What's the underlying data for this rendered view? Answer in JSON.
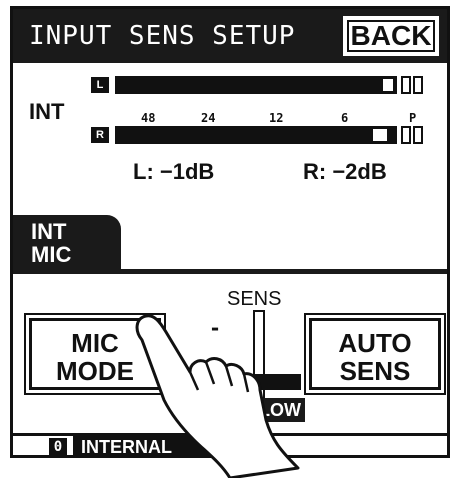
{
  "header": {
    "title": "INPUT SENS SETUP",
    "back_label": "BACK"
  },
  "meter": {
    "source_label": "INT",
    "left_badge": "L",
    "right_badge": "R",
    "scale": [
      "48",
      "24",
      "12",
      "6",
      "P"
    ],
    "left_readout": "L: −1dB",
    "right_readout": "R: −2dB"
  },
  "tab": {
    "line1": "INT",
    "line2": "MIC"
  },
  "panel": {
    "mic_mode_line1": "MIC",
    "mic_mode_line2": "MODE",
    "auto_sens_line1": "AUTO",
    "auto_sens_line2": "SENS",
    "sens_label": "SENS",
    "dash_mark": "-",
    "slider_value": "LOW"
  },
  "status": {
    "number": "0",
    "text": "INTERNAL"
  },
  "colors": {
    "screen_bg": "#ffffff",
    "dark": "#1a1a1a"
  }
}
